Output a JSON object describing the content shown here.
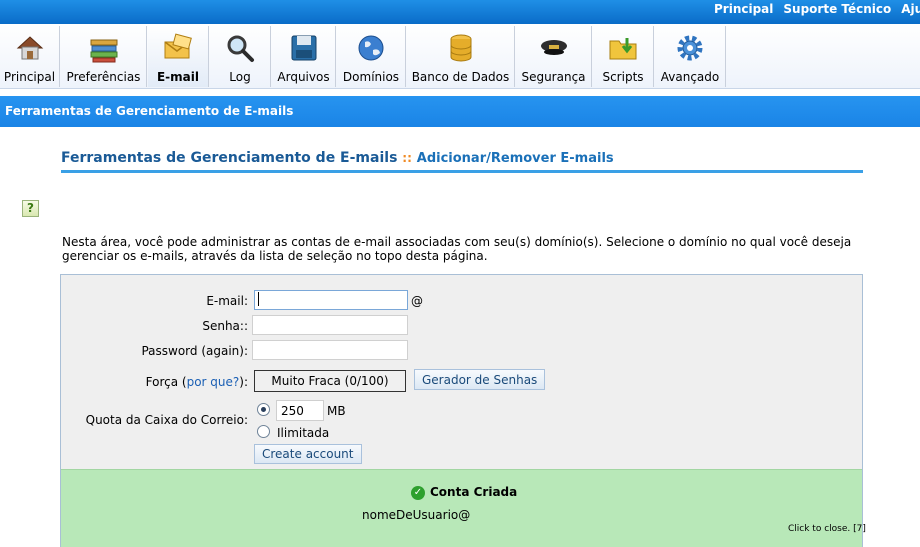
{
  "top_links": [
    "Principal",
    "Suporte Técnico",
    "Ajuda"
  ],
  "toolbar": {
    "items": [
      {
        "label": "Principal",
        "icon": "house-icon"
      },
      {
        "label": "Preferências",
        "icon": "books-icon"
      },
      {
        "label": "E-mail",
        "icon": "envelope-icon",
        "active": true
      },
      {
        "label": "Log",
        "icon": "magnifier-icon"
      },
      {
        "label": "Arquivos",
        "icon": "disk-icon"
      },
      {
        "label": "Domínios",
        "icon": "globe-icon"
      },
      {
        "label": "Banco de Dados",
        "icon": "database-icon"
      },
      {
        "label": "Segurança",
        "icon": "cap-icon"
      },
      {
        "label": "Scripts",
        "icon": "folder-icon"
      },
      {
        "label": "Avançado",
        "icon": "gear-icon"
      }
    ]
  },
  "section_bar": {
    "title": "Ferramentas de Gerenciamento de E-mails"
  },
  "page_title": {
    "main": "Ferramentas de Gerenciamento de E-mails",
    "separator": "::",
    "sub": "Adicionar/Remover E-mails"
  },
  "help": {
    "icon": "help-icon",
    "glyph": "?"
  },
  "intro_text": "Nesta área, você pode administrar as contas de e-mail associadas com seu(s) domínio(s). Selecione o domínio no qual você deseja gerenciar os e-mails, através da lista de seleção no topo desta página.",
  "form": {
    "email_label": "E-mail:",
    "email_value": "",
    "at_sign": "@",
    "password_label": "Senha::",
    "password_value": "",
    "password_again_label": "Password (again):",
    "password_again_value": "",
    "strength_label": "Força (",
    "strength_link": "por que?",
    "strength_label_end": "):",
    "strength_value": "Muito Fraca (0/100)",
    "generator_button": "Gerador de Senhas",
    "quota_label": "Quota da Caixa do Correio:",
    "quota_value": "250",
    "quota_unit": "MB",
    "unlimited_label": "Ilimitada",
    "create_button": "Create account"
  },
  "success": {
    "icon": "check-icon",
    "title": "Conta Criada",
    "username": "nomeDeUsuario@",
    "close_note": "Click to close. [7]"
  }
}
